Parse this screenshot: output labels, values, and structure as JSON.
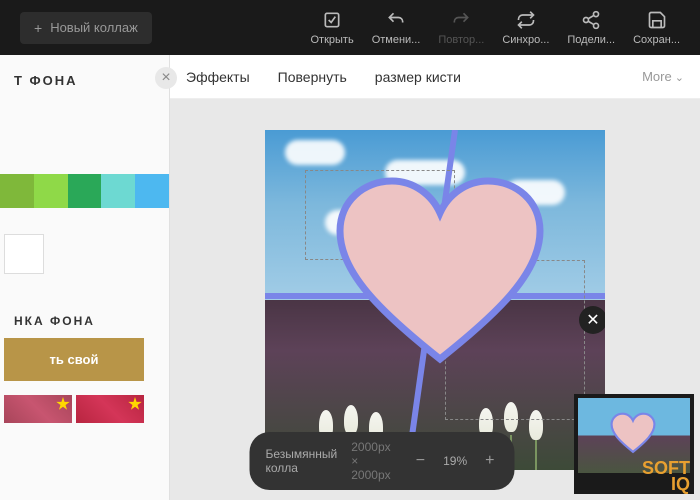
{
  "topbar": {
    "new_collage": "Новый коллаж",
    "actions": [
      {
        "label": "Открыть",
        "icon": "open-icon"
      },
      {
        "label": "Отмени...",
        "icon": "undo-icon"
      },
      {
        "label": "Повтор...",
        "icon": "redo-icon",
        "disabled": true
      },
      {
        "label": "Синхро...",
        "icon": "sync-icon"
      },
      {
        "label": "Подели...",
        "icon": "share-icon"
      },
      {
        "label": "Сохран...",
        "icon": "save-icon"
      }
    ]
  },
  "sidebar": {
    "title_bg": "Т ФОНА",
    "title_pattern": "НКА ФОНА",
    "colors": [
      "#7fb83a",
      "#8fd948",
      "#2aa858",
      "#6dd9d2",
      "#4db8f0"
    ],
    "upload_label": "ть свой"
  },
  "subtoolbar": {
    "effects": "Эффекты",
    "rotate": "Повернуть",
    "brush": "размер кисти",
    "more": "More"
  },
  "status": {
    "title": "Безымянный колла",
    "dimensions": "2000px × 2000px",
    "zoom": "19%"
  },
  "watermark": {
    "line1": "SOFT",
    "line2": "IQ"
  }
}
